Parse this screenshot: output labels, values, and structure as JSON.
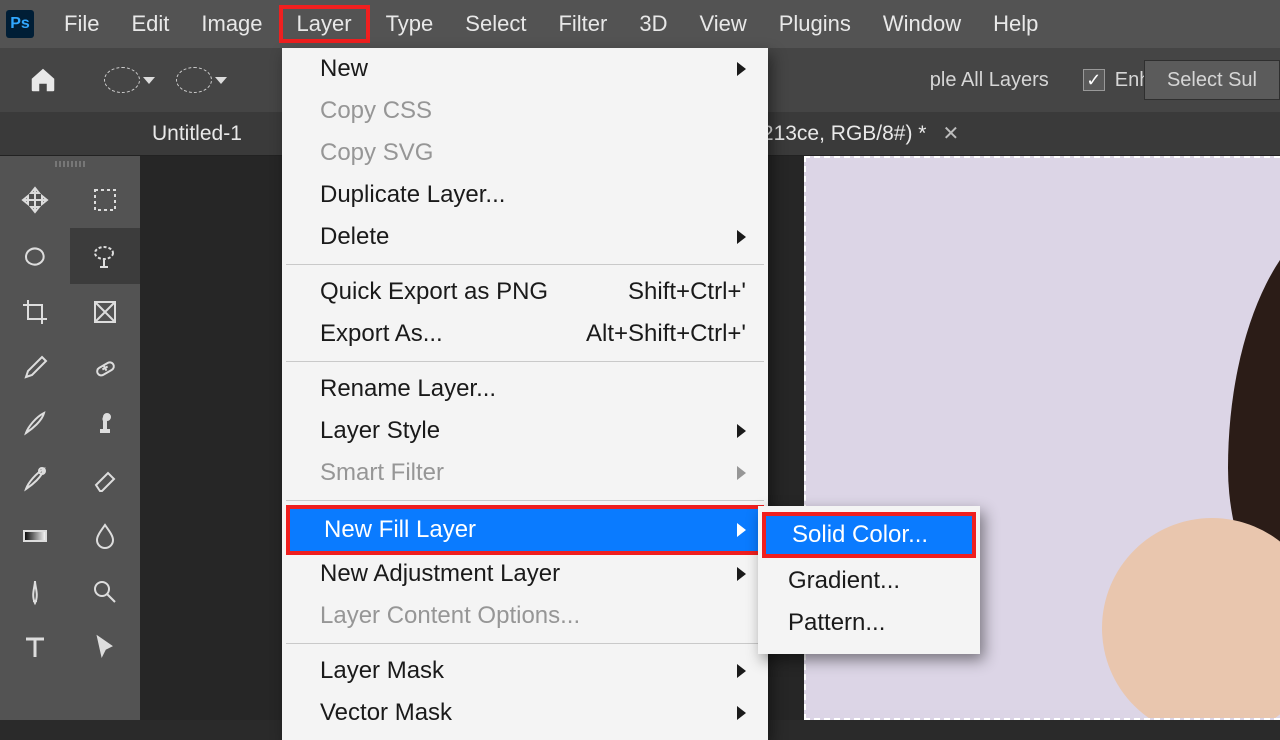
{
  "menubar": {
    "items": [
      "File",
      "Edit",
      "Image",
      "Layer",
      "Type",
      "Select",
      "Filter",
      "3D",
      "View",
      "Plugins",
      "Window",
      "Help"
    ],
    "open_index": 3
  },
  "optionsbar": {
    "sample_all": "ple All Layers",
    "enhance_edge": "Enhance Edge",
    "select_subject": "Select Sul"
  },
  "tab": {
    "title_left": "Untitled-1",
    "title_right": "213ce, RGB/8#) *"
  },
  "dropdown": [
    {
      "label": "New",
      "arrow": true
    },
    {
      "label": "Copy CSS",
      "disabled": true
    },
    {
      "label": "Copy SVG",
      "disabled": true
    },
    {
      "label": "Duplicate Layer..."
    },
    {
      "label": "Delete",
      "arrow": true
    },
    {
      "sep": true
    },
    {
      "label": "Quick Export as PNG",
      "shortcut": "Shift+Ctrl+'"
    },
    {
      "label": "Export As...",
      "shortcut": "Alt+Shift+Ctrl+'"
    },
    {
      "sep": true
    },
    {
      "label": "Rename Layer..."
    },
    {
      "label": "Layer Style",
      "arrow": true
    },
    {
      "label": "Smart Filter",
      "arrow": true,
      "disabled": true
    },
    {
      "sep": true
    },
    {
      "label": "New Fill Layer",
      "arrow": true,
      "highlight": true
    },
    {
      "label": "New Adjustment Layer",
      "arrow": true
    },
    {
      "label": "Layer Content Options...",
      "disabled": true
    },
    {
      "sep": true
    },
    {
      "label": "Layer Mask",
      "arrow": true
    },
    {
      "label": "Vector Mask",
      "arrow": true
    }
  ],
  "submenu": [
    {
      "label": "Solid Color...",
      "highlight": true
    },
    {
      "label": "Gradient..."
    },
    {
      "label": "Pattern..."
    }
  ],
  "tools": [
    {
      "name": "move"
    },
    {
      "name": "marquee"
    },
    {
      "name": "lasso"
    },
    {
      "name": "quick-select",
      "active": true
    },
    {
      "name": "crop"
    },
    {
      "name": "frame"
    },
    {
      "name": "eyedrop"
    },
    {
      "name": "healing"
    },
    {
      "name": "brush"
    },
    {
      "name": "stamp"
    },
    {
      "name": "history"
    },
    {
      "name": "eraser"
    },
    {
      "name": "gradient"
    },
    {
      "name": "blur"
    },
    {
      "name": "pen"
    },
    {
      "name": "dodge"
    },
    {
      "name": "type"
    },
    {
      "name": "path-sel"
    }
  ]
}
